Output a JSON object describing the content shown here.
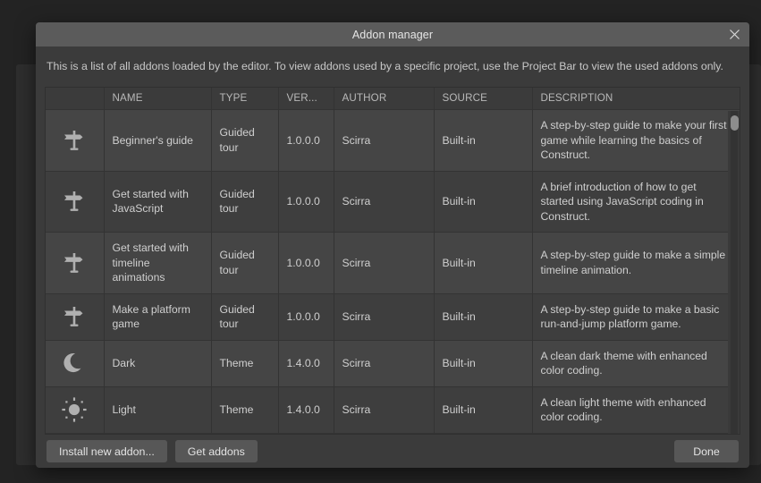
{
  "window": {
    "title": "Addon manager",
    "close_icon": "close-icon"
  },
  "intro": "This is a list of all addons loaded by the editor. To view addons used by a specific project, use the Project Bar to view the used addons only.",
  "table": {
    "columns": [
      "",
      "NAME",
      "TYPE",
      "VER...",
      "AUTHOR",
      "SOURCE",
      "DESCRIPTION"
    ],
    "rows": [
      {
        "icon": "signpost-icon",
        "name": "Beginner's guide",
        "type": "Guided tour",
        "version": "1.0.0.0",
        "author": "Scirra",
        "source": "Built-in",
        "description": "A step-by-step guide to make your first game while learning the basics of Construct."
      },
      {
        "icon": "signpost-icon",
        "name": "Get started with JavaScript",
        "type": "Guided tour",
        "version": "1.0.0.0",
        "author": "Scirra",
        "source": "Built-in",
        "description": "A brief introduction of how to get started using JavaScript coding in Construct."
      },
      {
        "icon": "signpost-icon",
        "name": "Get started with timeline animations",
        "type": "Guided tour",
        "version": "1.0.0.0",
        "author": "Scirra",
        "source": "Built-in",
        "description": "A step-by-step guide to make a simple timeline animation."
      },
      {
        "icon": "signpost-icon",
        "name": "Make a platform game",
        "type": "Guided tour",
        "version": "1.0.0.0",
        "author": "Scirra",
        "source": "Built-in",
        "description": "A step-by-step guide to make a basic run-and-jump platform game."
      },
      {
        "icon": "moon-icon",
        "name": "Dark",
        "type": "Theme",
        "version": "1.4.0.0",
        "author": "Scirra",
        "source": "Built-in",
        "description": "A clean dark theme with enhanced color coding."
      },
      {
        "icon": "sun-icon",
        "name": "Light",
        "type": "Theme",
        "version": "1.4.0.0",
        "author": "Scirra",
        "source": "Built-in",
        "description": "A clean light theme with enhanced color coding."
      }
    ]
  },
  "footer": {
    "install_label": "Install new addon...",
    "get_addons_label": "Get addons",
    "done_label": "Done"
  },
  "colors": {
    "dialog_bg": "#3b3b3b",
    "titlebar_bg": "#5b5b5b",
    "row_bg": "#454545",
    "row_alt_bg": "#3e3e3e",
    "text": "#cfcfcf",
    "icon_fill": "#b0b0b0",
    "button_bg": "#575757",
    "app_bg": "#232323"
  }
}
